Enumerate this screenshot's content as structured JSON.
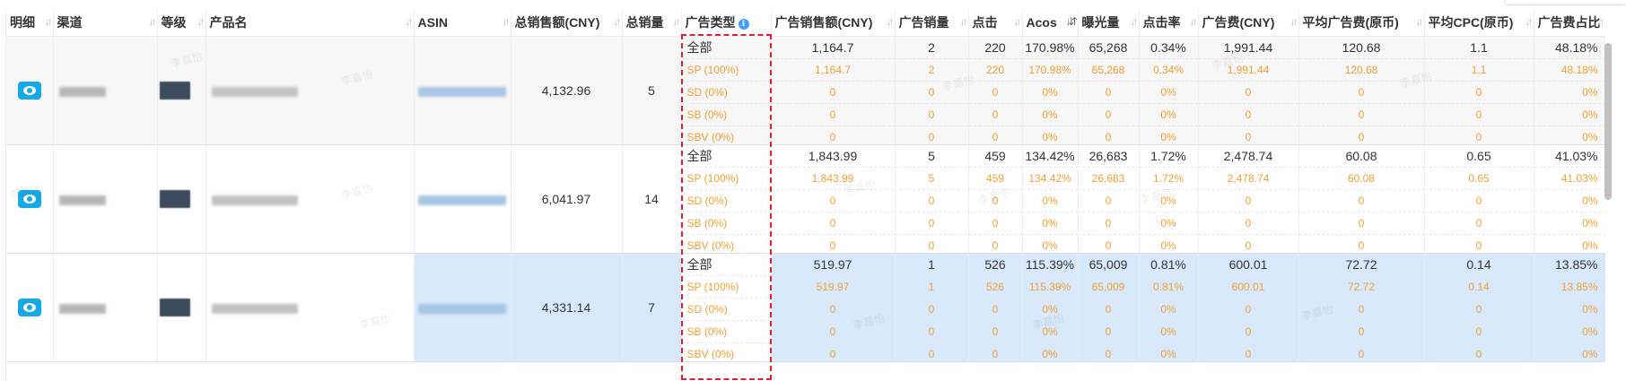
{
  "columns": [
    {
      "label": "明细",
      "sortable": true
    },
    {
      "label": "渠道",
      "sortable": true
    },
    {
      "label": "等级",
      "sortable": true
    },
    {
      "label": "产品名",
      "sortable": true
    },
    {
      "label": "ASIN",
      "sortable": true
    },
    {
      "label": "总销售额(CNY)",
      "sortable": true
    },
    {
      "label": "总销量",
      "sortable": true
    },
    {
      "label": "广告类型",
      "info": true
    },
    {
      "label": "广告销售额(CNY)",
      "sortable": true
    },
    {
      "label": "广告销量",
      "sortable": true
    },
    {
      "label": "点击",
      "sortable": true
    },
    {
      "label": "Acos",
      "sortable": true,
      "active_sort": "desc"
    },
    {
      "label": "曝光量",
      "sortable": true
    },
    {
      "label": "点击率",
      "sortable": true
    },
    {
      "label": "广告费(CNY)",
      "sortable": true
    },
    {
      "label": "平均广告费(原币)",
      "sortable": true
    },
    {
      "label": "平均CPC(原币)",
      "sortable": true
    },
    {
      "label": "广告费占比",
      "sortable": true
    }
  ],
  "ad_type_labels": [
    "全部",
    "SP (100%)",
    "SD (0%)",
    "SB (0%)",
    "SBV (0%)"
  ],
  "rows": [
    {
      "total_sales": "4,132.96",
      "total_qty": "5",
      "ad_sales": [
        "1,164.7",
        "1,164.7",
        "0",
        "0",
        "0"
      ],
      "ad_qty": [
        "2",
        "2",
        "0",
        "0",
        "0"
      ],
      "clicks": [
        "220",
        "220",
        "0",
        "0",
        "0"
      ],
      "acos": [
        "170.98%",
        "170.98%",
        "0%",
        "0%",
        "0%"
      ],
      "impressions": [
        "65,268",
        "65,268",
        "0",
        "0",
        "0"
      ],
      "ctr": [
        "0.34%",
        "0.34%",
        "0%",
        "0%",
        "0%"
      ],
      "ad_spend": [
        "1,991.44",
        "1,991.44",
        "0",
        "0",
        "0"
      ],
      "avg_ad_spend": [
        "120.68",
        "120.68",
        "0",
        "0",
        "0"
      ],
      "avg_cpc": [
        "1.1",
        "1.1",
        "0",
        "0",
        "0"
      ],
      "ad_spend_ratio": [
        "48.18%",
        "48.18%",
        "0%",
        "0%",
        "0%"
      ]
    },
    {
      "total_sales": "6,041.97",
      "total_qty": "14",
      "ad_sales": [
        "1,843.99",
        "1,843.99",
        "0",
        "0",
        "0"
      ],
      "ad_qty": [
        "5",
        "5",
        "0",
        "0",
        "0"
      ],
      "clicks": [
        "459",
        "459",
        "0",
        "0",
        "0"
      ],
      "acos": [
        "134.42%",
        "134.42%",
        "0%",
        "0%",
        "0%"
      ],
      "impressions": [
        "26,683",
        "26,683",
        "0",
        "0",
        "0"
      ],
      "ctr": [
        "1.72%",
        "1.72%",
        "0%",
        "0%",
        "0%"
      ],
      "ad_spend": [
        "2,478.74",
        "2,478.74",
        "0",
        "0",
        "0"
      ],
      "avg_ad_spend": [
        "60.08",
        "60.08",
        "0",
        "0",
        "0"
      ],
      "avg_cpc": [
        "0.65",
        "0.65",
        "0",
        "0",
        "0"
      ],
      "ad_spend_ratio": [
        "41.03%",
        "41.03%",
        "0%",
        "0%",
        "0%"
      ]
    },
    {
      "total_sales": "4,331.14",
      "total_qty": "7",
      "ad_sales": [
        "519.97",
        "519.97",
        "0",
        "0",
        "0"
      ],
      "ad_qty": [
        "1",
        "1",
        "0",
        "0",
        "0"
      ],
      "clicks": [
        "526",
        "526",
        "0",
        "0",
        "0"
      ],
      "acos": [
        "115.39%",
        "115.39%",
        "0%",
        "0%",
        "0%"
      ],
      "impressions": [
        "65,009",
        "65,009",
        "0",
        "0",
        "0"
      ],
      "ctr": [
        "0.81%",
        "0.81%",
        "0%",
        "0%",
        "0%"
      ],
      "ad_spend": [
        "600.01",
        "600.01",
        "0",
        "0",
        "0"
      ],
      "avg_ad_spend": [
        "72.72",
        "72.72",
        "0",
        "0",
        "0"
      ],
      "avg_cpc": [
        "0.14",
        "0.14",
        "0",
        "0",
        "0"
      ],
      "ad_spend_ratio": [
        "13.85%",
        "13.85%",
        "0%",
        "0%",
        "0%"
      ]
    }
  ],
  "watermark": "李嘉怡",
  "colors": {
    "accent": "#16a9e9",
    "sub_row": "#f0a030",
    "highlight": "#d8e9fb",
    "annotation": "#e0202a"
  }
}
